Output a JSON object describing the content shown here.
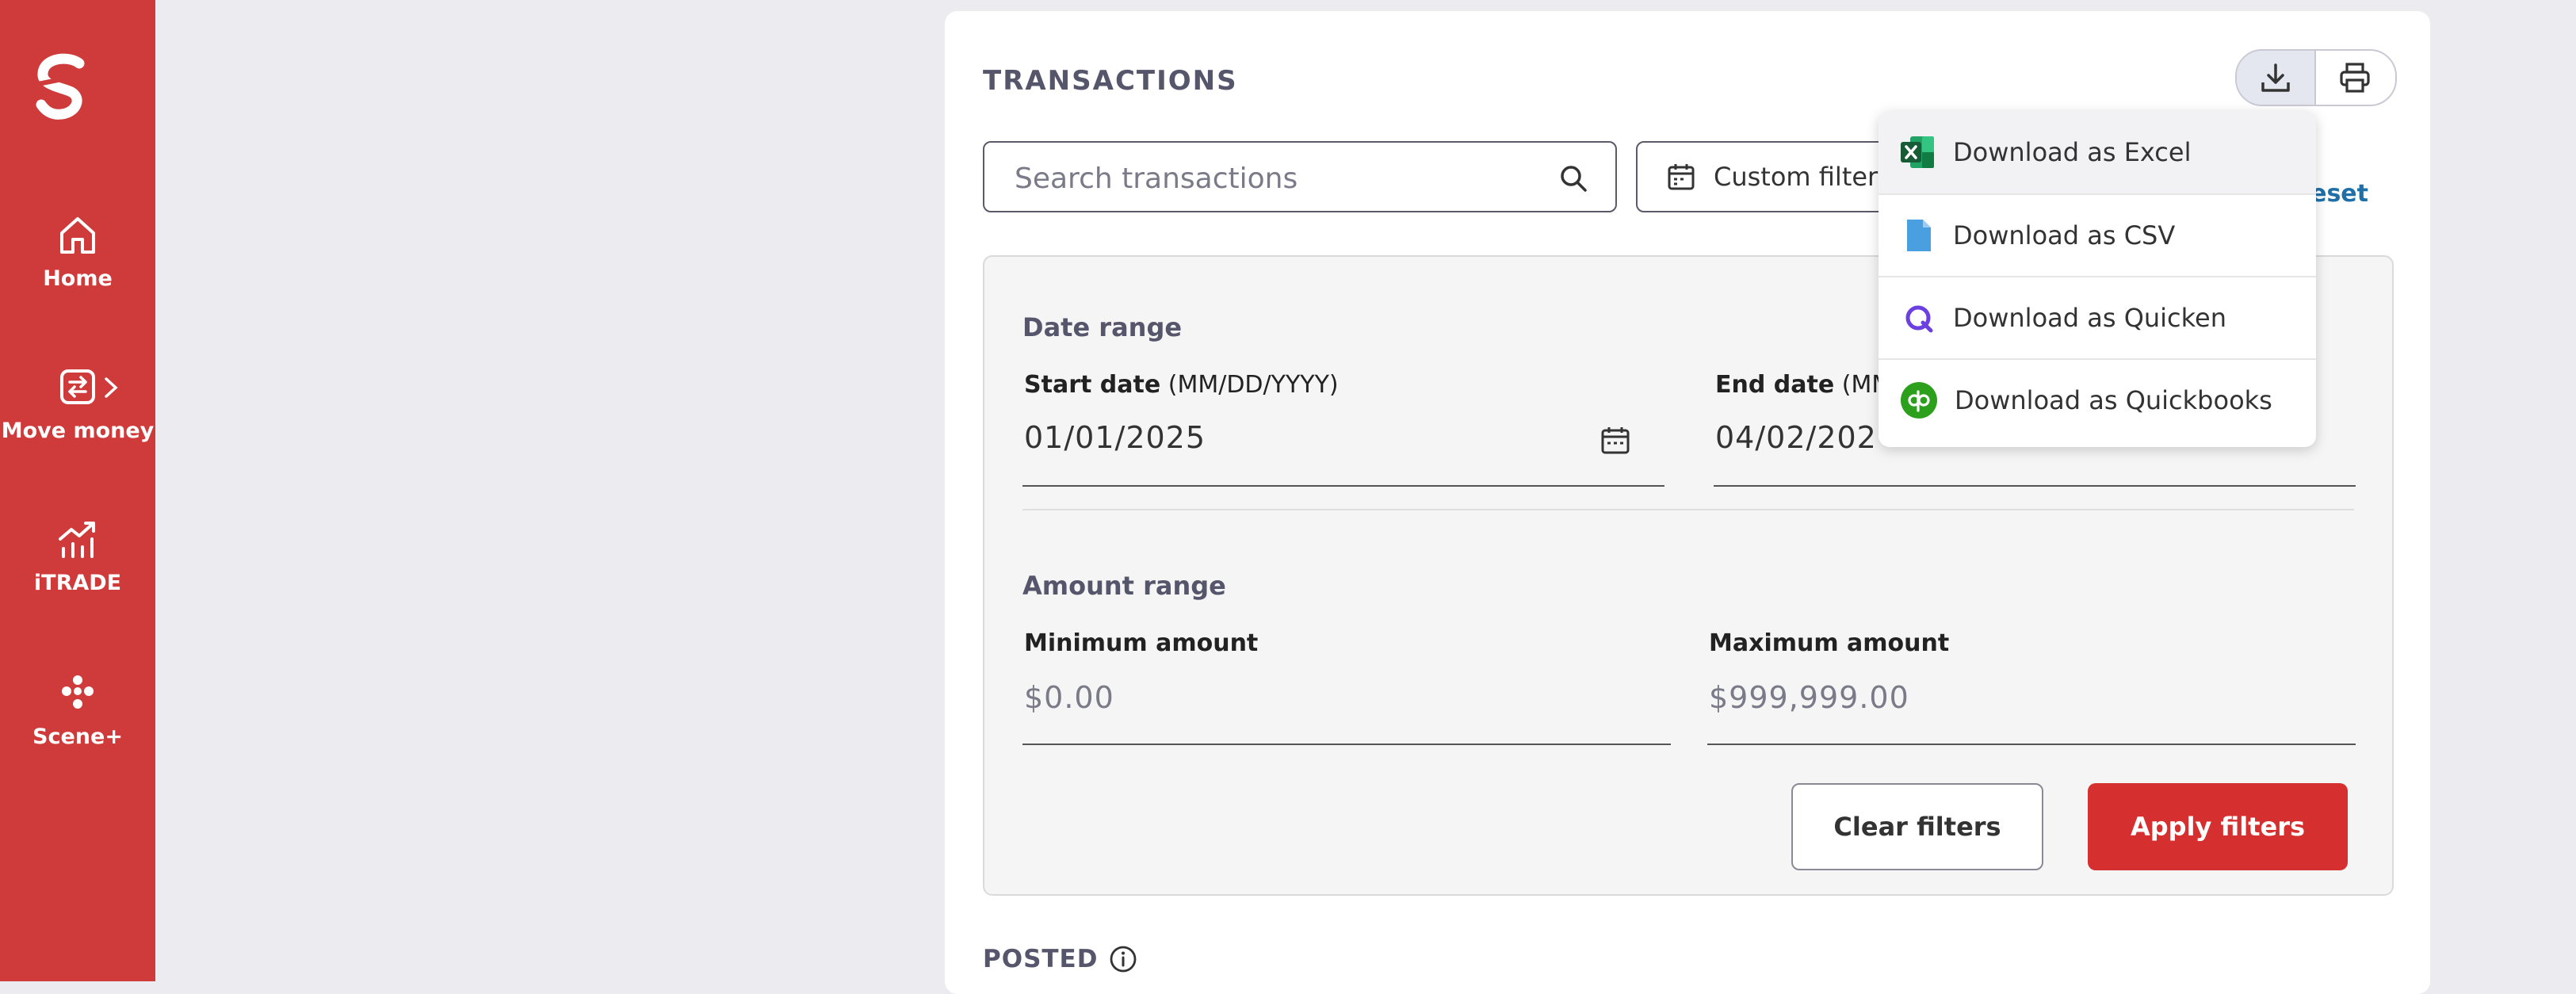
{
  "sidebar": {
    "brand_color": "#cf3a3a",
    "items": [
      {
        "label": "Home",
        "icon": "home-icon"
      },
      {
        "label": "Move money",
        "icon": "transfer-icon"
      },
      {
        "label": "iTRADE",
        "icon": "chart-trend-icon"
      },
      {
        "label": "Scene+",
        "icon": "dots-icon"
      }
    ]
  },
  "card": {
    "title": "TRANSACTIONS",
    "search": {
      "placeholder": "Search transactions",
      "value": ""
    },
    "custom_filters_label": "Custom filters",
    "reset_label": "Reset"
  },
  "filters": {
    "date_range_title": "Date range",
    "start_date": {
      "label": "Start date",
      "hint": "(MM/DD/YYYY)",
      "value": "01/01/2025"
    },
    "end_date": {
      "label": "End date",
      "hint": "(MM/",
      "value": "04/02/202"
    },
    "amount_range_title": "Amount range",
    "min_amount": {
      "label": "Minimum amount",
      "placeholder": "$0.00"
    },
    "max_amount": {
      "label": "Maximum amount",
      "placeholder": "$999,999.00"
    },
    "clear_label": "Clear filters",
    "apply_label": "Apply filters",
    "apply_color": "#d62f2f"
  },
  "posted_label": "POSTED",
  "download_menu": {
    "items": [
      {
        "label": "Download as Excel",
        "icon": "excel-icon"
      },
      {
        "label": "Download as CSV",
        "icon": "csv-file-icon"
      },
      {
        "label": "Download as Quicken",
        "icon": "quicken-icon"
      },
      {
        "label": "Download as Quickbooks",
        "icon": "quickbooks-icon"
      }
    ]
  }
}
